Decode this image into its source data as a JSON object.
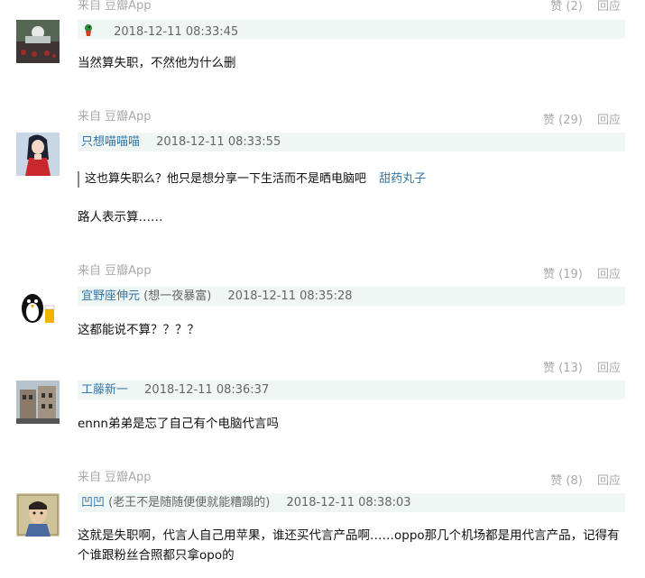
{
  "comments": [
    {
      "source": "来自 豆瓣App",
      "like": "赞 (2)",
      "reply": "回应",
      "author": "",
      "time": "2018-12-11 08:33:45",
      "content": "当然算失职，不然他为什么删"
    },
    {
      "source": "来自 豆瓣App",
      "like": "赞 (29)",
      "reply": "回应",
      "author": "只想喵喵喵",
      "time": "2018-12-11 08:33:55",
      "quote_text": "这也算失职么？他只是想分享一下生活而不是晒电脑吧",
      "quote_author": "甜药丸子",
      "content": "路人表示算……"
    },
    {
      "source": "来自 豆瓣App",
      "like": "赞 (19)",
      "reply": "回应",
      "author": "宜野座伸元",
      "note": " (想一夜暴富)",
      "time": "2018-12-11 08:35:28",
      "content": "这都能说不算？？？？"
    },
    {
      "like": "赞 (13)",
      "reply": "回应",
      "author": "工藤新一",
      "time": "2018-12-11 08:36:37",
      "content": "ennn弟弟是忘了自己有个电脑代言吗"
    },
    {
      "source": "来自 豆瓣App",
      "like": "赞 (8)",
      "reply": "回应",
      "author": "凹凹",
      "note": " (老王不是随随便便就能糟蹋的)",
      "time": "2018-12-11 08:38:03",
      "content": "这就是失职啊，代言人自己用苹果，谁还买代言产品啊……oppo那几个机场都是用代言产品，记得有个谁跟粉丝合照都只拿opo的"
    }
  ],
  "colors": {
    "link": "#3377aa",
    "meta": "#aaaaaa",
    "header_bg": "#f0f6f3"
  }
}
